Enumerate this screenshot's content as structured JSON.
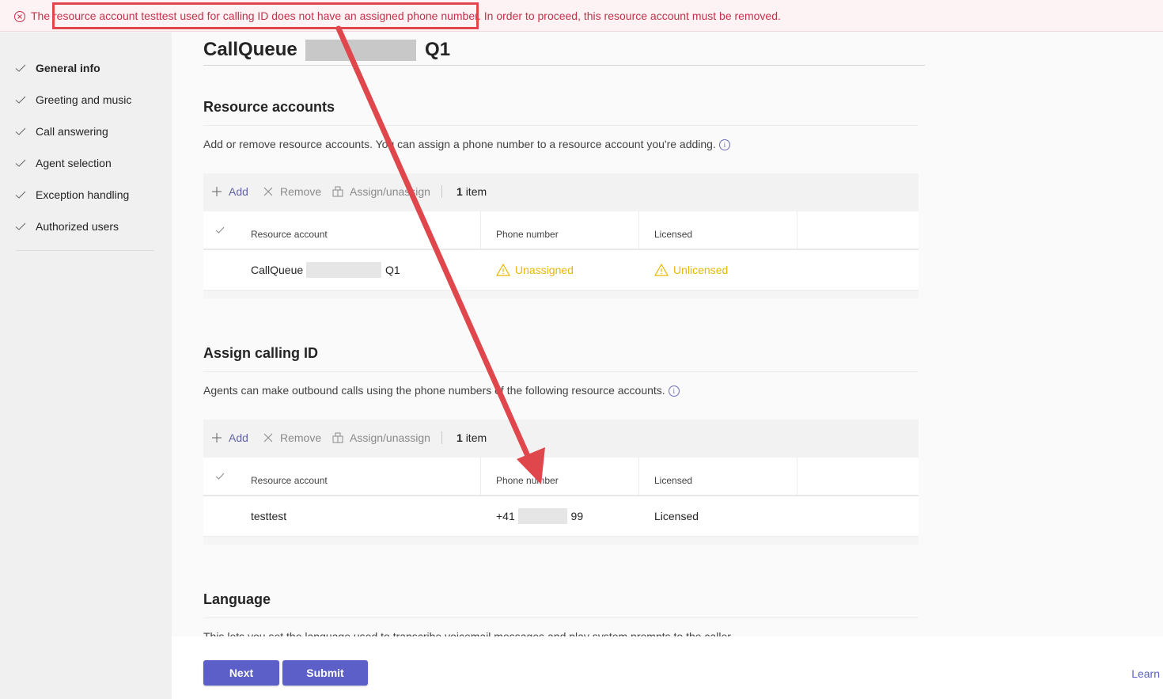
{
  "banner": {
    "message": "The resource account testtest used for calling ID does not have an assigned phone number. In order to proceed, this resource account must be removed.",
    "color": "#c4314b"
  },
  "sidebar": {
    "items": [
      {
        "label": "General info",
        "state": "active"
      },
      {
        "label": "Greeting and music",
        "state": "done"
      },
      {
        "label": "Call answering",
        "state": "done"
      },
      {
        "label": "Agent selection",
        "state": "done"
      },
      {
        "label": "Exception handling",
        "state": "done"
      },
      {
        "label": "Authorized users",
        "state": "done"
      }
    ]
  },
  "page": {
    "title_prefix": "CallQueue",
    "title_suffix": "Q1"
  },
  "resource_accounts": {
    "title": "Resource accounts",
    "description": "Add or remove resource accounts. You can assign a phone number to a resource account you're adding.",
    "toolbar": {
      "add": "Add",
      "remove": "Remove",
      "assign": "Assign/unassign",
      "count_num": "1",
      "count_label": "item"
    },
    "columns": [
      "Resource account",
      "Phone number",
      "Licensed"
    ],
    "rows": [
      {
        "account_prefix": "CallQueue",
        "account_suffix": "Q1",
        "phone": "Unassigned",
        "licensed": "Unlicensed"
      }
    ]
  },
  "calling_id": {
    "title": "Assign calling ID",
    "description": "Agents can make outbound calls using the phone numbers of the following resource accounts.",
    "toolbar": {
      "add": "Add",
      "remove": "Remove",
      "assign": "Assign/unassign",
      "count_num": "1",
      "count_label": "item"
    },
    "columns": [
      "Resource account",
      "Phone number",
      "Licensed"
    ],
    "rows": [
      {
        "account": "testtest",
        "phone_prefix": "+41",
        "phone_suffix": "99",
        "licensed": "Licensed"
      }
    ]
  },
  "language": {
    "title": "Language",
    "description": "This lets you set the language used to transcribe voicemail messages and play system prompts to the caller."
  },
  "footer": {
    "next": "Next",
    "submit": "Submit",
    "learn": "Learn"
  },
  "colors": {
    "accent": "#5b5fc7",
    "warning": "#e8b800",
    "annotation": "#e0474c"
  }
}
